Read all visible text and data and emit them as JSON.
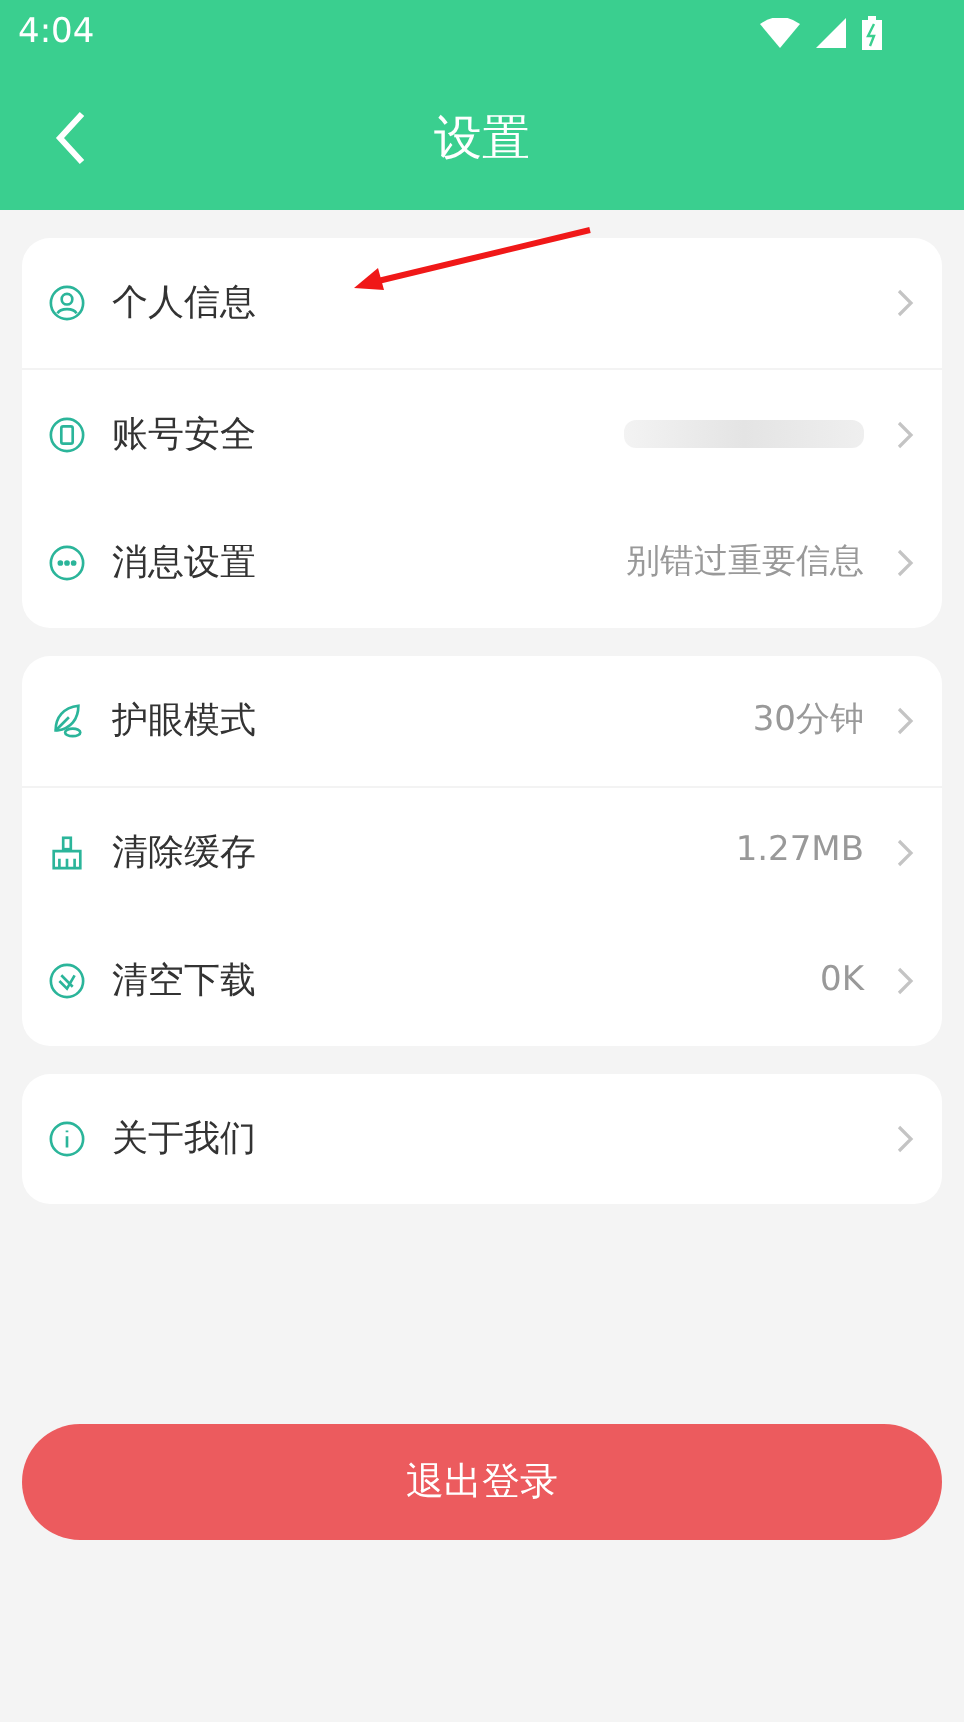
{
  "status_bar": {
    "time": "4:04"
  },
  "header": {
    "title": "设置"
  },
  "groups": [
    {
      "items": [
        {
          "label": "个人信息",
          "kind": "plain"
        },
        {
          "label": "账号安全",
          "kind": "redacted"
        },
        {
          "label": "消息设置",
          "kind": "value",
          "value": "别错过重要信息"
        }
      ]
    },
    {
      "items": [
        {
          "label": "护眼模式",
          "kind": "value",
          "value": "30分钟"
        },
        {
          "label": "清除缓存",
          "kind": "value",
          "value": "1.27MB"
        },
        {
          "label": "清空下载",
          "kind": "value",
          "value": "0K"
        }
      ]
    },
    {
      "items": [
        {
          "label": "关于我们",
          "kind": "plain"
        }
      ]
    }
  ],
  "logout_button": "退出登录"
}
